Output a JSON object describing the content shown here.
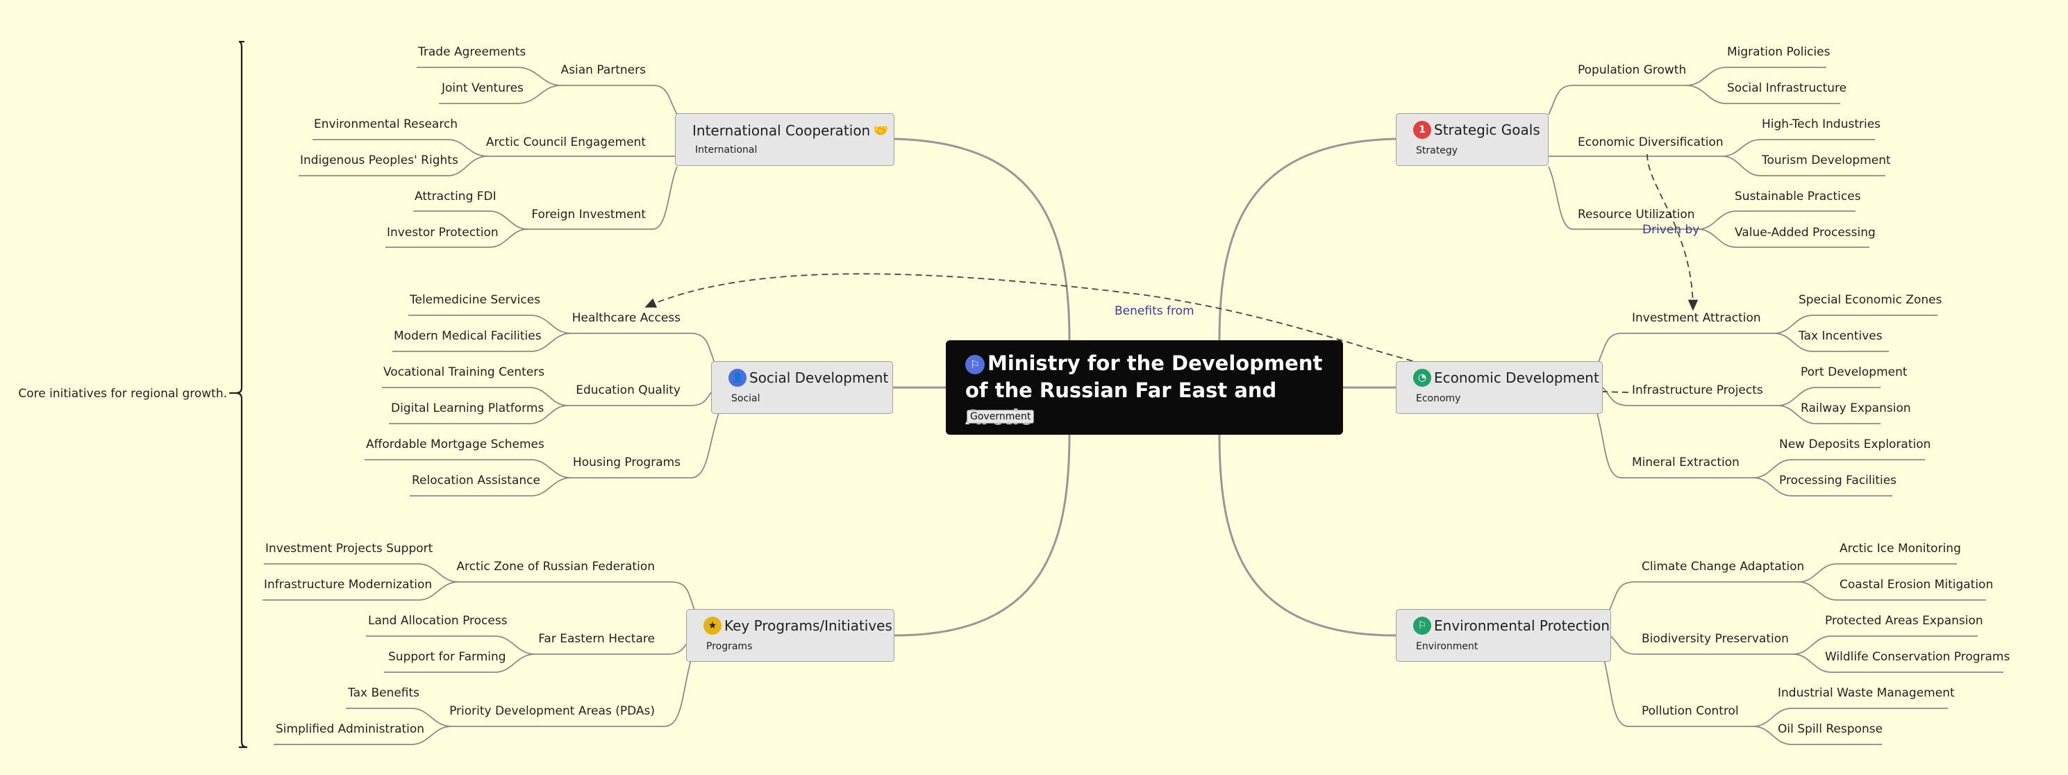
{
  "summary": "Core initiatives for regional growth.",
  "central": {
    "title": "Ministry for the Development of the Russian Far East and Arctic",
    "tag": "Government",
    "icon": "flag-icon",
    "color": "#5470e0"
  },
  "relations": {
    "benefits_from": "Benefits from",
    "driven_by": "Driven by"
  },
  "branches": {
    "international": {
      "title": "International Cooperation",
      "tag": "International",
      "icon": "handshake-icon",
      "subs": [
        {
          "label": "Asian Partners",
          "leaves": [
            "Trade Agreements",
            "Joint Ventures"
          ]
        },
        {
          "label": "Arctic Council Engagement",
          "leaves": [
            "Environmental Research",
            "Indigenous Peoples' Rights"
          ]
        },
        {
          "label": "Foreign Investment",
          "leaves": [
            "Attracting FDI",
            "Investor Protection"
          ]
        }
      ]
    },
    "social": {
      "title": "Social Development",
      "tag": "Social",
      "icon": "person-icon",
      "subs": [
        {
          "label": "Healthcare Access",
          "leaves": [
            "Telemedicine Services",
            "Modern Medical Facilities"
          ]
        },
        {
          "label": "Education Quality",
          "leaves": [
            "Vocational Training Centers",
            "Digital Learning Platforms"
          ]
        },
        {
          "label": "Housing Programs",
          "leaves": [
            "Affordable Mortgage Schemes",
            "Relocation Assistance"
          ]
        }
      ]
    },
    "programs": {
      "title": "Key Programs/Initiatives",
      "tag": "Programs",
      "icon": "star-icon",
      "subs": [
        {
          "label": "Arctic Zone of Russian Federation",
          "leaves": [
            "Investment Projects Support",
            "Infrastructure Modernization"
          ]
        },
        {
          "label": "Far Eastern Hectare",
          "leaves": [
            "Land Allocation Process",
            "Support for Farming"
          ]
        },
        {
          "label": "Priority Development Areas (PDAs)",
          "leaves": [
            "Tax Benefits",
            "Simplified Administration"
          ]
        }
      ]
    },
    "strategy": {
      "title": "Strategic Goals",
      "tag": "Strategy",
      "icon": "number-one-icon",
      "icon_text": "1",
      "subs": [
        {
          "label": "Population Growth",
          "leaves": [
            "Migration Policies",
            "Social Infrastructure"
          ]
        },
        {
          "label": "Economic Diversification",
          "leaves": [
            "High-Tech Industries",
            "Tourism Development"
          ]
        },
        {
          "label": "Resource Utilization",
          "leaves": [
            "Sustainable Practices",
            "Value-Added Processing"
          ]
        }
      ]
    },
    "economy": {
      "title": "Economic Development",
      "tag": "Economy",
      "icon": "pie-chart-icon",
      "subs": [
        {
          "label": "Investment Attraction",
          "leaves": [
            "Special Economic Zones",
            "Tax Incentives"
          ]
        },
        {
          "label": "Infrastructure Projects",
          "leaves": [
            "Port Development",
            "Railway Expansion"
          ]
        },
        {
          "label": "Mineral Extraction",
          "leaves": [
            "New Deposits Exploration",
            "Processing Facilities"
          ]
        }
      ]
    },
    "environment": {
      "title": "Environmental Protection",
      "tag": "Environment",
      "icon": "leaf-icon",
      "subs": [
        {
          "label": "Climate Change Adaptation",
          "leaves": [
            "Arctic Ice Monitoring",
            "Coastal Erosion Mitigation"
          ]
        },
        {
          "label": "Biodiversity Preservation",
          "leaves": [
            "Protected Areas Expansion",
            "Wildlife Conservation Programs"
          ]
        },
        {
          "label": "Pollution Control",
          "leaves": [
            "Industrial Waste Management",
            "Oil Spill Response"
          ]
        }
      ]
    }
  }
}
